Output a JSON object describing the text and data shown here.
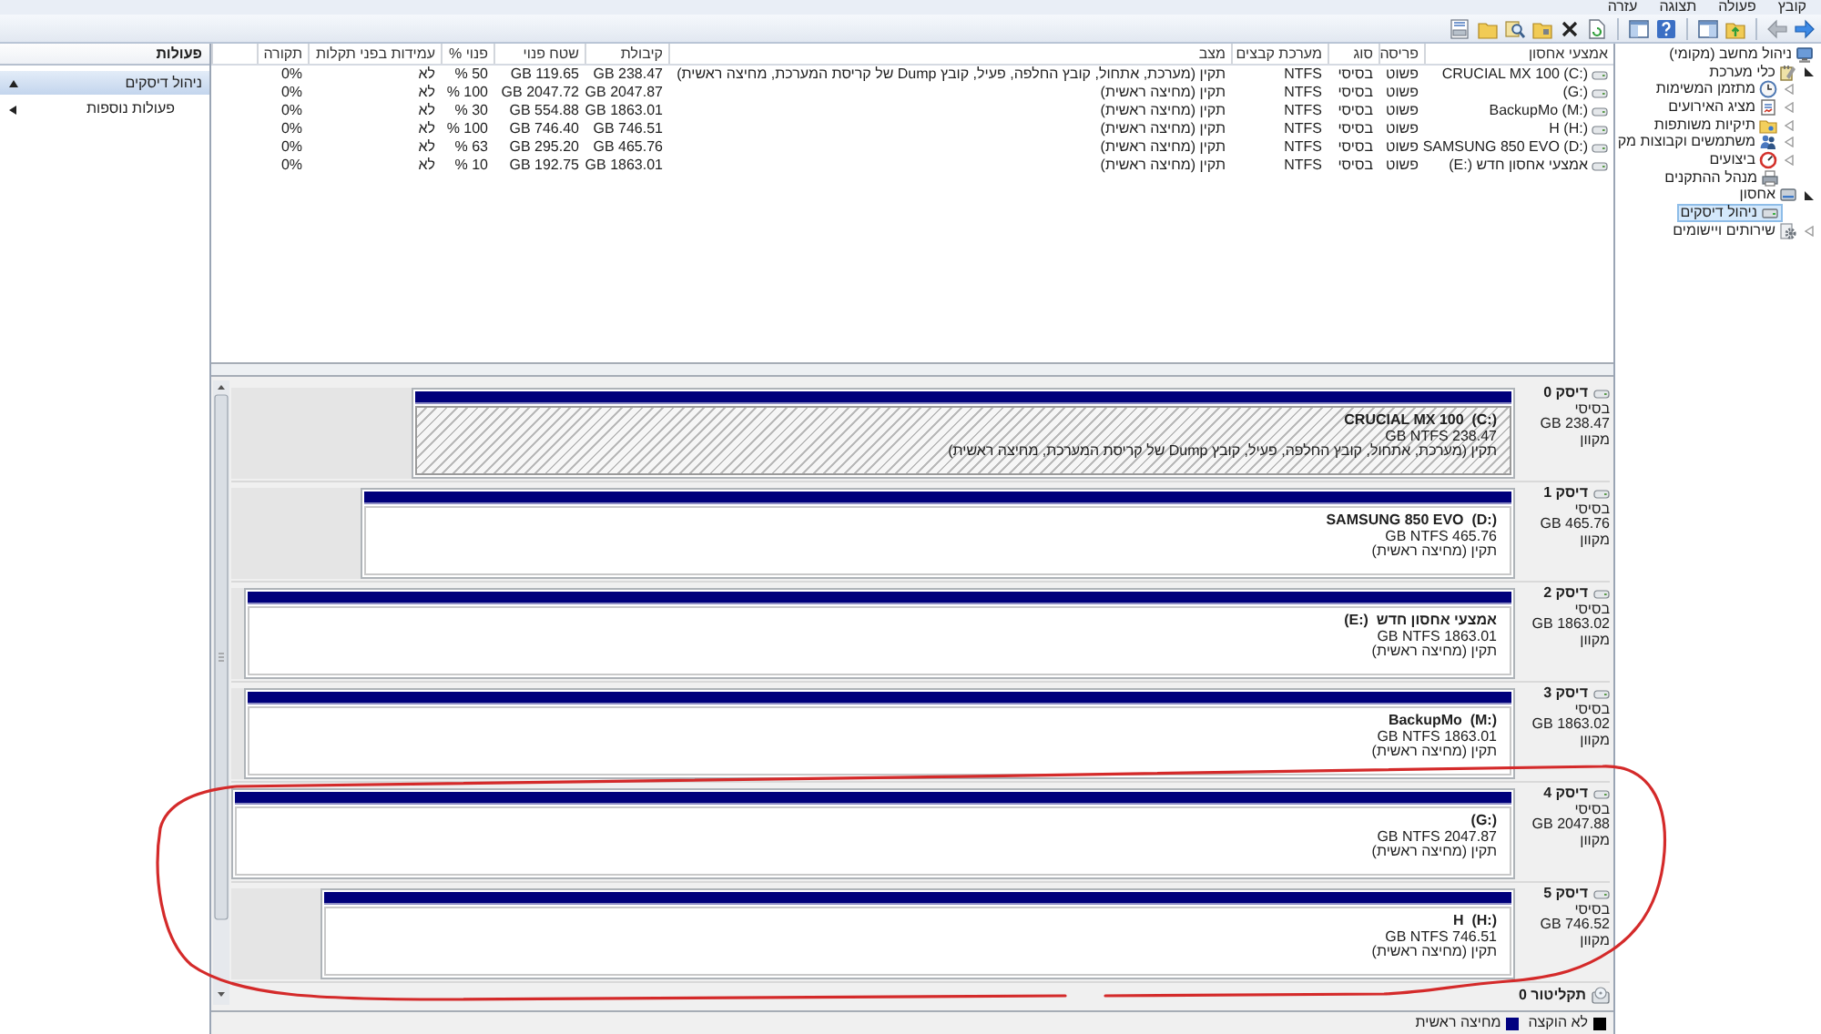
{
  "menu": [
    "קובץ",
    "פעולה",
    "תצוגה",
    "עזרה"
  ],
  "tree": [
    {
      "label": "ניהול מחשב (מקומי)",
      "selected": false,
      "children": [
        {
          "label": "כלי מערכת",
          "expanded": true,
          "selected": false,
          "children": [
            {
              "label": "מתזמן המשימות",
              "expanded": false,
              "selected": false
            },
            {
              "label": "מציג האירועים",
              "expanded": false,
              "selected": false
            },
            {
              "label": "תיקיות משותפות",
              "expanded": false,
              "selected": false
            },
            {
              "label": "משתמשים וקבוצות מק",
              "expanded": false,
              "selected": false
            },
            {
              "label": "ביצועים",
              "expanded": false,
              "selected": false
            },
            {
              "label": "מנהל ההתקנים",
              "selected": false
            }
          ]
        },
        {
          "label": "אחסון",
          "expanded": true,
          "selected": false,
          "children": [
            {
              "label": "ניהול דיסקים",
              "selected": true
            }
          ]
        },
        {
          "label": "שירותים ויישומים",
          "expanded": false,
          "selected": false
        }
      ]
    }
  ],
  "volume_table": {
    "columns": [
      "אמצעי אחסון",
      "פריסה",
      "סוג",
      "מערכת קבצים",
      "מצב",
      "קיבולת",
      "שטח פנוי",
      "פנוי %",
      "עמידות בפני תקלות",
      "תקורה"
    ],
    "rows": [
      {
        "cells": [
          "CRUCIAL MX 100 (C:)",
          "פשוט",
          "בסיסי",
          "NTFS",
          "תקין (מערכת, אתחול, קובץ החלפה, פעיל, קובץ Dump של קריסת המערכת, מחיצה ראשית)",
          "GB 238.47",
          "GB 119.65",
          "% 50",
          "לא",
          "0%"
        ]
      },
      {
        "cells": [
          "(G:)",
          "פשוט",
          "בסיסי",
          "NTFS",
          "תקין (מחיצה ראשית)",
          "GB 2047.87",
          "GB 2047.72",
          "% 100",
          "לא",
          "0%"
        ]
      },
      {
        "cells": [
          "BackupMo (M:)",
          "פשוט",
          "בסיסי",
          "NTFS",
          "תקין (מחיצה ראשית)",
          "GB 1863.01",
          "GB 554.88",
          "% 30",
          "לא",
          "0%"
        ]
      },
      {
        "cells": [
          "H (H:)",
          "פשוט",
          "בסיסי",
          "NTFS",
          "תקין (מחיצה ראשית)",
          "GB 746.51",
          "GB 746.40",
          "% 100",
          "לא",
          "0%"
        ]
      },
      {
        "cells": [
          "SAMSUNG 850 EVO (D:)",
          "פשוט",
          "בסיסי",
          "NTFS",
          "תקין (מחיצה ראשית)",
          "GB 465.76",
          "GB 295.20",
          "% 63",
          "לא",
          "0%"
        ]
      },
      {
        "cells": [
          "אמצעי אחסון חדש ‎(E:)",
          "פשוט",
          "בסיסי",
          "NTFS",
          "תקין (מחיצה ראשית)",
          "GB 1863.01",
          "GB 192.75",
          "% 10",
          "לא",
          "0%"
        ]
      }
    ]
  },
  "disks": [
    {
      "label": "דיסק 0",
      "type": "בסיסי",
      "size": "GB 238.47",
      "status": "מקוון",
      "partition": {
        "name": "CRUCIAL MX 100  (C:)",
        "size": "GB NTFS 238.47",
        "status": "תקין (מערכת, אתחול, קובץ החלפה, פעיל, קובץ Dump של קריסת המערכת, מחיצה ראשית)",
        "selected": true,
        "level": 0.86
      }
    },
    {
      "label": "דיסק 1",
      "type": "בסיסי",
      "size": "GB 465.76",
      "status": "מקוון",
      "partition": {
        "name": "SAMSUNG 850 EVO  (D:)",
        "size": "GB NTFS 465.76",
        "status": "תקין (מחיצה ראשית)",
        "selected": false,
        "level": 0.9
      }
    },
    {
      "label": "דיסק 2",
      "type": "בסיסי",
      "size": "GB 1863.02",
      "status": "מקוון",
      "partition": {
        "name": "אמצעי אחסון חדש  ‎(E:)",
        "size": "GB NTFS 1863.01",
        "status": "תקין (מחיצה ראשית)",
        "selected": false,
        "level": 0.99
      }
    },
    {
      "label": "דיסק 3",
      "type": "בסיסי",
      "size": "GB 1863.02",
      "status": "מקוון",
      "partition": {
        "name": "BackupMo  (M:)",
        "size": "GB NTFS 1863.01",
        "status": "תקין (מחיצה ראשית)",
        "selected": false,
        "level": 0.99
      }
    },
    {
      "label": "דיסק 4",
      "type": "בסיסי",
      "size": "GB 2047.88",
      "status": "מקוון",
      "partition": {
        "name": "(G:)",
        "size": "GB NTFS 2047.87",
        "status": "תקין (מחיצה ראשית)",
        "selected": false,
        "level": 1
      }
    },
    {
      "label": "דיסק 5",
      "type": "בסיסי",
      "size": "GB 746.52",
      "status": "מקוון",
      "partition": {
        "name": "H  (H:)",
        "size": "GB NTFS 746.51",
        "status": "תקין (מחיצה ראשית)",
        "selected": false,
        "level": 0.93
      }
    }
  ],
  "cdrom": {
    "label": "תקליטור 0"
  },
  "legend": [
    {
      "label": "לא הוקצה",
      "color": "#000000"
    },
    {
      "label": "מחיצה ראשית",
      "color": "#000080"
    }
  ],
  "actions": {
    "title": "פעולות",
    "items": [
      {
        "label": "ניהול דיסקים",
        "kind": "section"
      },
      {
        "label": "פעולות נוספות",
        "kind": "submenu"
      }
    ]
  }
}
